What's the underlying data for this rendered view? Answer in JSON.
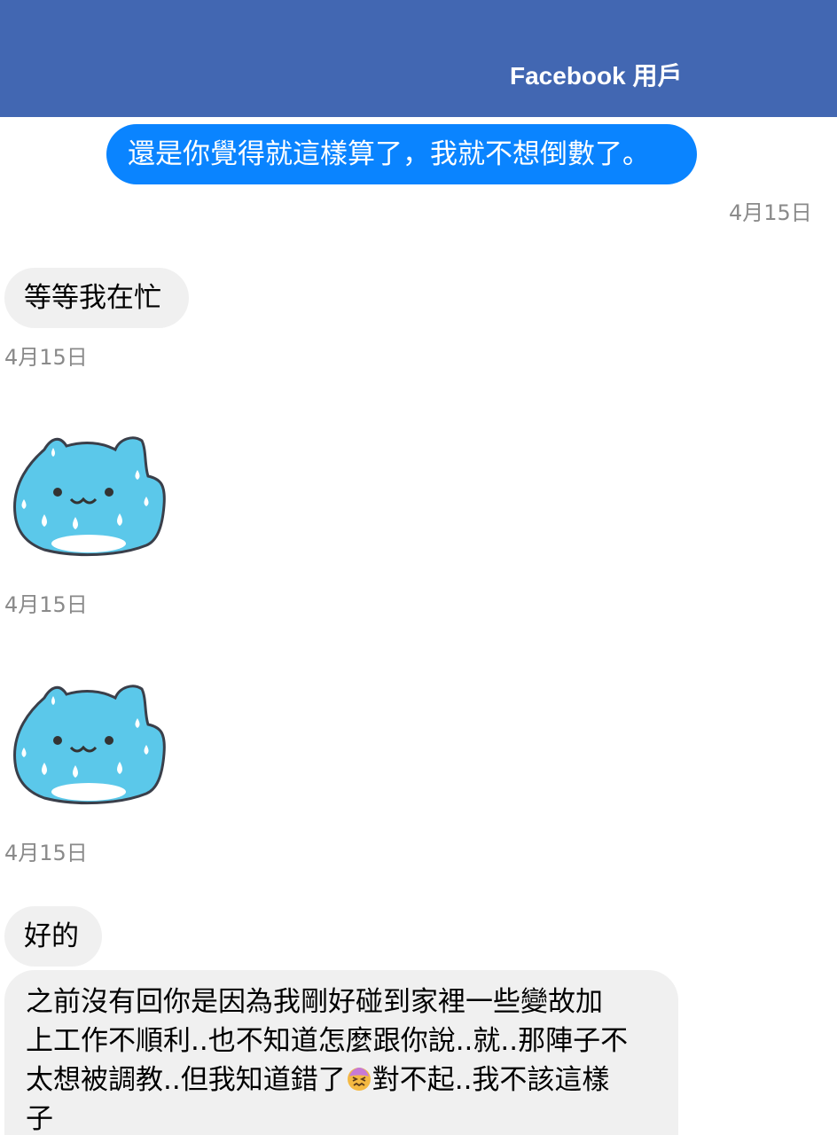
{
  "header": {
    "title": "Facebook 用戶"
  },
  "messages": [
    {
      "direction": "outgoing",
      "text": "還是你覺得就這樣算了，我就不想倒數了。",
      "timestamp": "4月15日"
    },
    {
      "direction": "incoming",
      "text": "等等我在忙",
      "timestamp": "4月15日"
    },
    {
      "direction": "incoming",
      "type": "sticker",
      "sticker": "blue-cat-sweating",
      "timestamp": "4月15日"
    },
    {
      "direction": "incoming",
      "type": "sticker",
      "sticker": "blue-cat-sweating",
      "timestamp": "4月15日"
    },
    {
      "direction": "incoming",
      "text": "好的"
    },
    {
      "direction": "incoming",
      "lines": [
        "之前沒有回你是因為我剛好碰到家裡一些變故加",
        "上工作不順利..也不知道怎麼跟你說..就..那陣子不",
        "太想被調教..但我知道錯了",
        "對不起..我不該這樣",
        "子"
      ],
      "emoji": "confounded-face"
    }
  ],
  "colors": {
    "header": "#4267b2",
    "outgoing_bubble": "#0a84ff",
    "incoming_bubble": "#f0f0f0",
    "timestamp": "#8a8a8a"
  }
}
